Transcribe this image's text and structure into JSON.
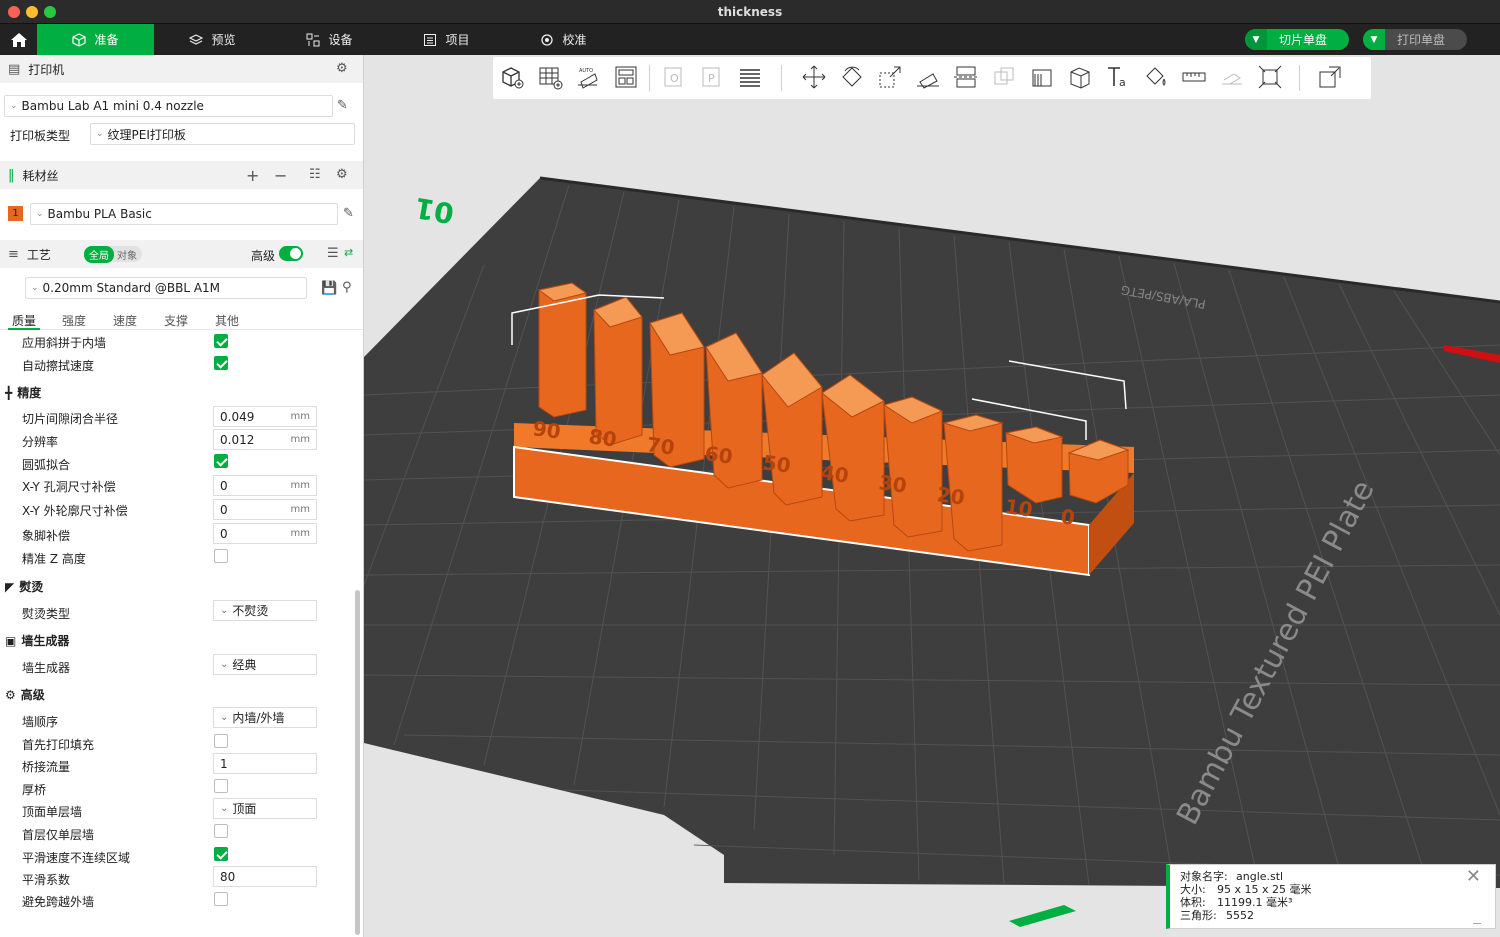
{
  "window": {
    "title": "thickness"
  },
  "nav": {
    "tabs": [
      {
        "label": "准备",
        "icon": "cube-icon"
      },
      {
        "label": "预览",
        "icon": "layers-icon"
      },
      {
        "label": "设备",
        "icon": "device-icon"
      },
      {
        "label": "项目",
        "icon": "project-icon"
      },
      {
        "label": "校准",
        "icon": "calibration-icon"
      }
    ],
    "slice_button": "切片单盘",
    "print_button": "打印单盘"
  },
  "printer": {
    "section_title": "打印机",
    "selected": "Bambu Lab A1 mini 0.4 nozzle",
    "plate_label": "打印板类型",
    "plate_value": "纹理PEI打印板"
  },
  "filament": {
    "section_title": "耗材丝",
    "slot_number": "1",
    "slot_color": "#e8671f",
    "selected": "Bambu PLA Basic"
  },
  "process": {
    "section_title": "工艺",
    "toggle_global": "全局",
    "toggle_object": "对象",
    "advanced_label": "高级",
    "preset": "0.20mm Standard @BBL A1M",
    "tabs": [
      "质量",
      "强度",
      "速度",
      "支撑",
      "其他"
    ]
  },
  "settings": {
    "top_rows": [
      {
        "label": "应用斜拼于内墙",
        "checked": true
      },
      {
        "label": "自动擦拭速度",
        "checked": true
      }
    ],
    "precision": {
      "title": "精度",
      "slice_gap_label": "切片间隙闭合半径",
      "slice_gap_value": "0.049",
      "slice_gap_unit": "mm",
      "resolution_label": "分辨率",
      "resolution_value": "0.012",
      "resolution_unit": "mm",
      "arc_label": "圆弧拟合",
      "xy_hole_label": "X-Y 孔洞尺寸补偿",
      "xy_hole_value": "0",
      "xy_hole_unit": "mm",
      "xy_contour_label": "X-Y 外轮廓尺寸补偿",
      "xy_contour_value": "0",
      "xy_contour_unit": "mm",
      "elephant_label": "象脚补偿",
      "elephant_value": "0",
      "elephant_unit": "mm",
      "precise_z_label": "精准 Z 高度"
    },
    "ironing": {
      "title": "熨烫",
      "type_label": "熨烫类型",
      "type_value": "不熨烫"
    },
    "wall_generator": {
      "title": "墙生成器",
      "label": "墙生成器",
      "value": "经典"
    },
    "advanced": {
      "title": "高级",
      "wall_order_label": "墙顺序",
      "wall_order_value": "内墙/外墙",
      "infill_first_label": "首先打印填充",
      "bridge_flow_label": "桥接流量",
      "bridge_flow_value": "1",
      "thick_bridge_label": "厚桥",
      "top_one_wall_label": "顶面单层墙",
      "top_one_wall_value": "顶面",
      "first_layer_one_wall_label": "首层仅单层墙",
      "smooth_speed_label": "平滑速度不连续区域",
      "smooth_coef_label": "平滑系数",
      "smooth_coef_value": "80",
      "avoid_crossing_label": "避免跨越外墙"
    }
  },
  "plate": {
    "number": "01",
    "name": "Bambu Textured PEI Plate",
    "material_marks": "PLA/ABS/PETG",
    "model_labels": [
      "90",
      "80",
      "70",
      "60",
      "50",
      "40",
      "30",
      "20",
      "10",
      "0"
    ]
  },
  "object_info": {
    "name_label": "对象名字:",
    "name_value": "angle.stl",
    "size_label": "大小:",
    "size_value": "95 x 15 x 25 毫米",
    "volume_label": "体积:",
    "volume_value": "11199.1 毫米³",
    "triangles_label": "三角形:",
    "triangles_value": "5552"
  },
  "colors": {
    "accent": "#00ae42",
    "model": "#e8671f",
    "plate": "#3d3d3d"
  }
}
